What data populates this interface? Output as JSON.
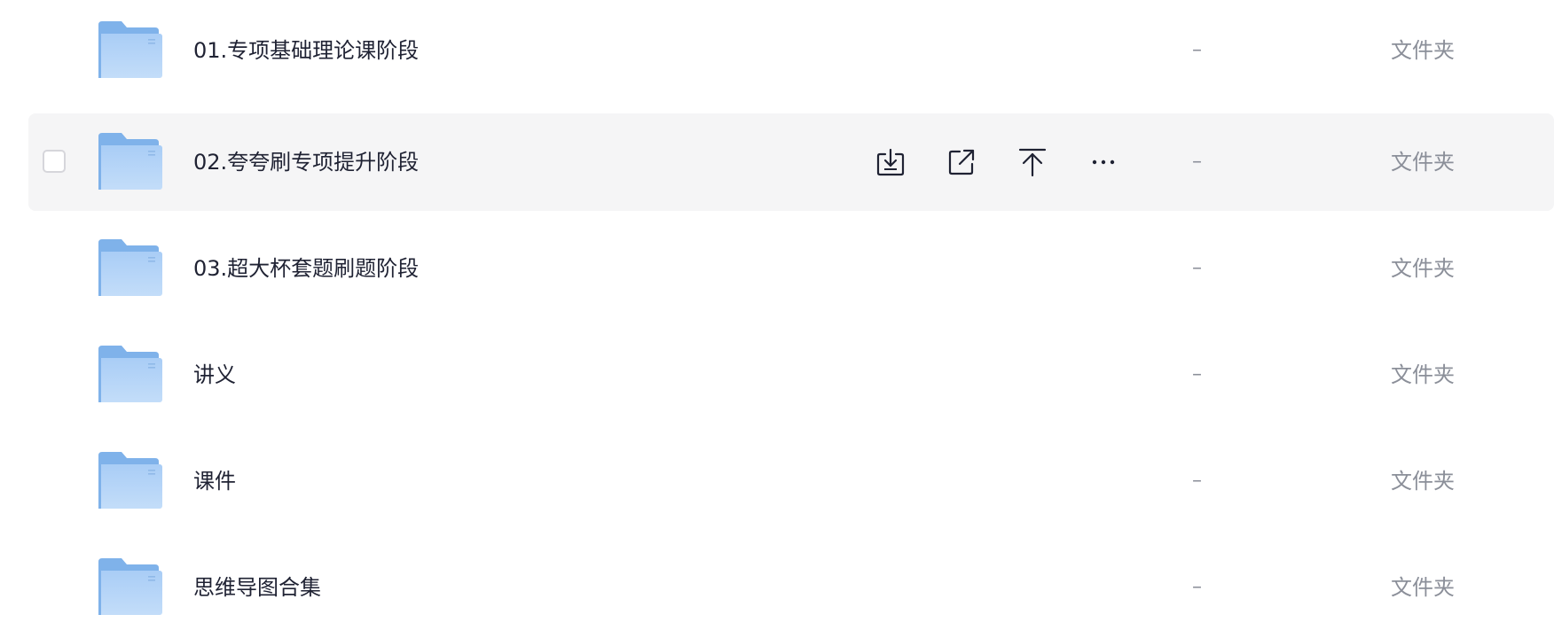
{
  "files": [
    {
      "name": "01.专项基础理论课阶段",
      "size": "–",
      "type": "文件夹"
    },
    {
      "name": "02.夸夸刷专项提升阶段",
      "size": "–",
      "type": "文件夹"
    },
    {
      "name": "03.超大杯套题刷题阶段",
      "size": "–",
      "type": "文件夹"
    },
    {
      "name": "讲义",
      "size": "–",
      "type": "文件夹"
    },
    {
      "name": "课件",
      "size": "–",
      "type": "文件夹"
    },
    {
      "name": "思维导图合集",
      "size": "–",
      "type": "文件夹"
    }
  ],
  "row_actions": [
    "download-icon",
    "share-icon",
    "upload-icon",
    "more-icon"
  ],
  "colors": {
    "hover_bg": "#f5f5f6",
    "folder_back": "#7fb2ea",
    "folder_front": "#b9d7f8",
    "name_text": "#1f2233",
    "meta_text": "#8b8f99"
  }
}
